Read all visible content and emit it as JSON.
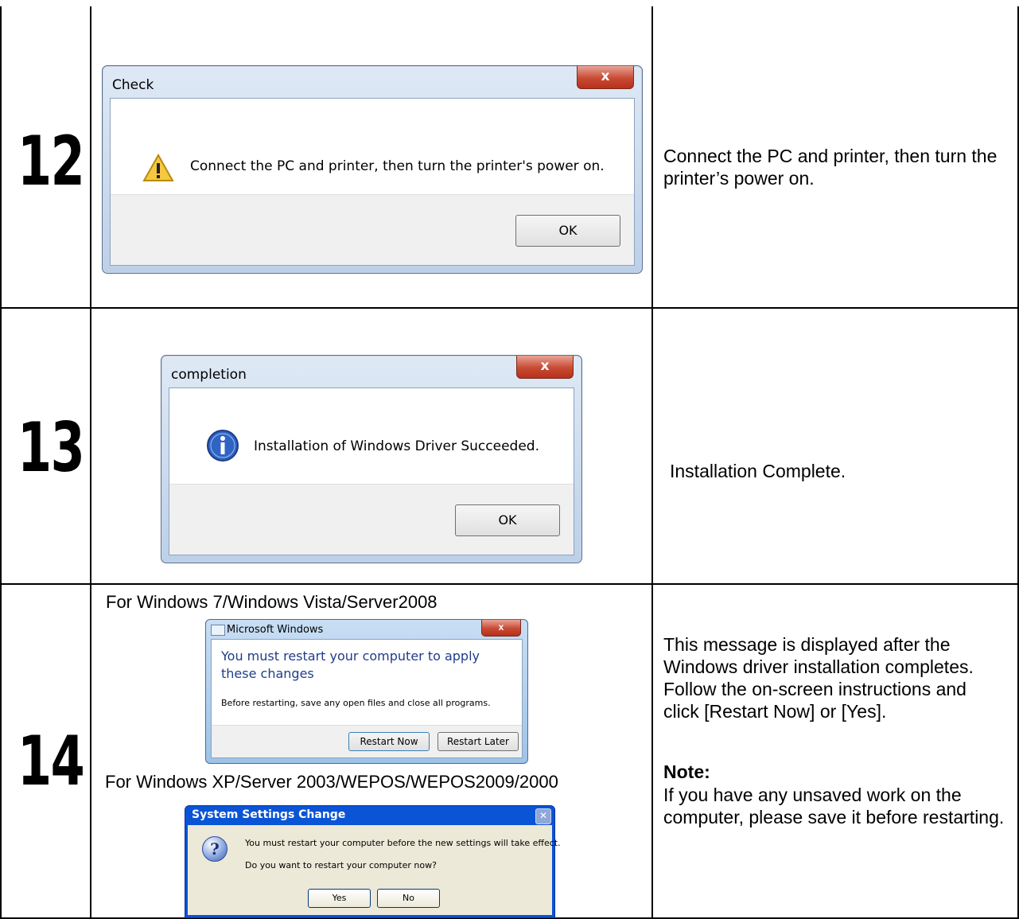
{
  "steps": [
    {
      "number": "12",
      "dialog": {
        "title": "Check",
        "close": "x",
        "message": "Connect the PC and printer, then turn the printer's power on.",
        "ok": "OK",
        "icon": "warning-icon"
      },
      "description": "Connect the PC and printer, then turn the printer’s power on."
    },
    {
      "number": "13",
      "dialog": {
        "title": "completion",
        "close": "x",
        "message": "Installation of Windows Driver Succeeded.",
        "ok": "OK",
        "icon": "info-icon"
      },
      "description": "Installation Complete."
    },
    {
      "number": "14",
      "caption_vista": "For Windows 7/Windows Vista/Server2008",
      "vista_dialog": {
        "title": "Microsoft Windows",
        "close": "x",
        "heading": "You must restart your computer to apply these changes",
        "sub": "Before restarting, save any open files and close all programs.",
        "restart_now": "Restart Now",
        "restart_later": "Restart Later"
      },
      "caption_xp": "For Windows XP/Server 2003/WEPOS/WEPOS2009/2000",
      "xp_dialog": {
        "title": "System Settings Change",
        "close": "✕",
        "icon_glyph": "?",
        "line1": "You must restart your computer before the new settings will take effect.",
        "line2": "Do you want to restart your computer now?",
        "yes": "Yes",
        "no": "No"
      },
      "description": "This message is displayed after the Windows driver installation completes. Follow the on-screen instructions and click [Restart Now] or [Yes].",
      "note_label": "Note:",
      "note_text": "If you have any unsaved work on the computer, please save it before restarting."
    }
  ]
}
